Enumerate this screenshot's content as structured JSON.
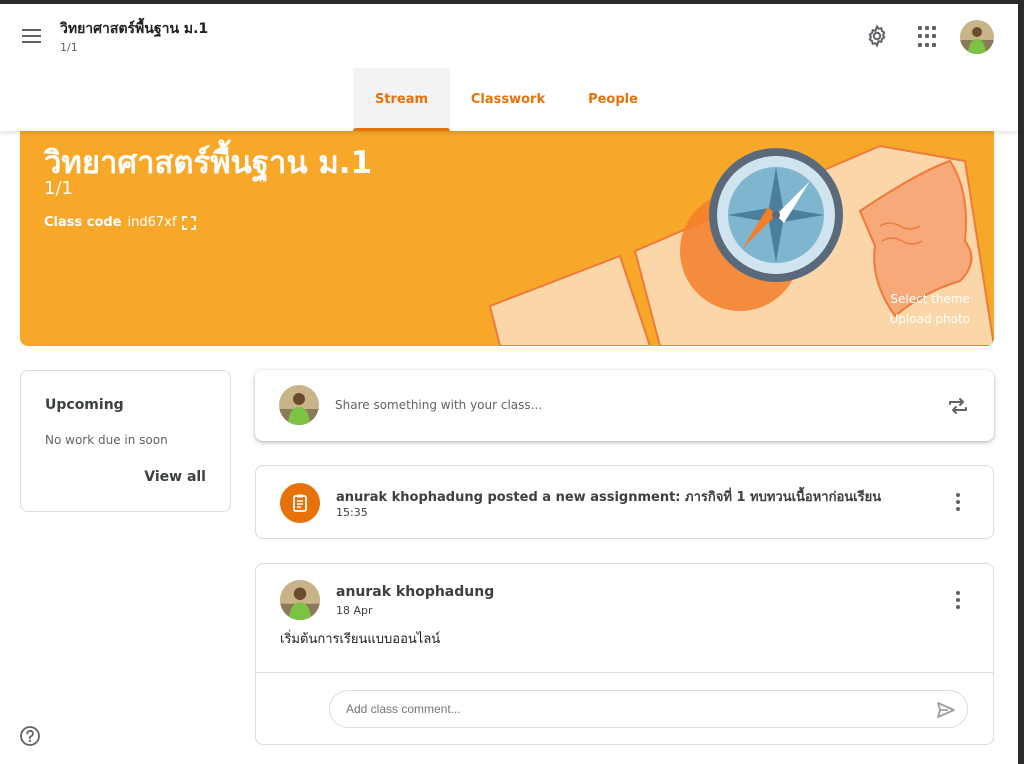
{
  "header": {
    "title": "วิทยาศาสตร์พื้นฐาน ม.1",
    "subtitle": "1/1",
    "icons": [
      "menu-icon",
      "gear-icon",
      "apps-grid-icon",
      "user-avatar"
    ]
  },
  "tabs": [
    {
      "label": "Stream",
      "active": true
    },
    {
      "label": "Classwork",
      "active": false
    },
    {
      "label": "People",
      "active": false
    }
  ],
  "banner": {
    "title": "วิทยาศาสตร์พื้นฐาน ม.1",
    "section": "1/1",
    "class_code_label": "Class code",
    "class_code": "ind67xf",
    "select_theme": "Select theme",
    "upload_photo": "Upload photo"
  },
  "upcoming": {
    "title": "Upcoming",
    "empty_text": "No work due in soon",
    "view_all": "View all"
  },
  "share": {
    "placeholder": "Share something with your class..."
  },
  "stream": {
    "assignment": {
      "text": "anurak khophadung posted a new assignment: ภารกิจที่ 1 ทบทวนเนื้อหาก่อนเรียน",
      "time": "15:35"
    },
    "post": {
      "author": "anurak khophadung",
      "date": "18 Apr",
      "body": "เริ่มต้นการเรียนแบบออนไลน์",
      "comment_placeholder": "Add class comment..."
    }
  },
  "colors": {
    "accent": "#e8710a",
    "banner": "#f7a829",
    "text": "#3c4043"
  }
}
